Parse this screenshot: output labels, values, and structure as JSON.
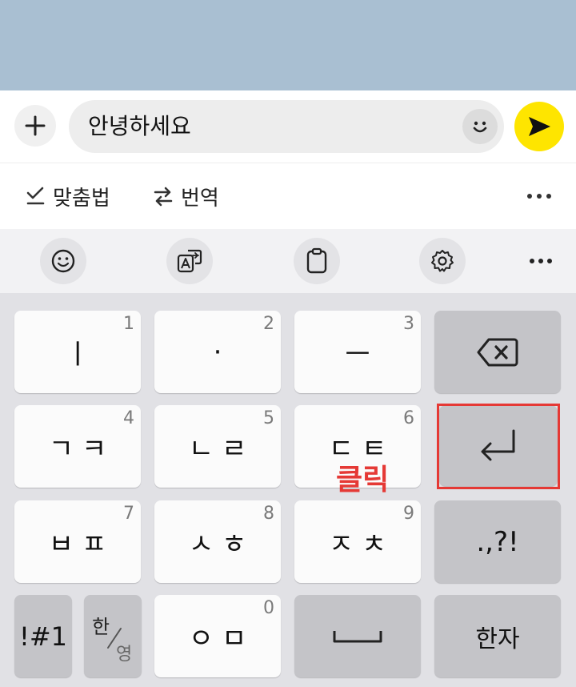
{
  "input_bar": {
    "message_text": "안녕하세요"
  },
  "suggestions": {
    "spellcheck_label": "맞춤법",
    "translate_label": "번역",
    "more_label": "···"
  },
  "toolbar": {
    "icons": [
      "emoji-icon",
      "translate-icon",
      "clipboard-icon",
      "settings-icon"
    ],
    "more_label": "···"
  },
  "keyboard": {
    "rows": [
      [
        {
          "label": "ㅣ",
          "num": "1"
        },
        {
          "label": "·",
          "num": "2"
        },
        {
          "label": "ㅡ",
          "num": "3"
        },
        {
          "label": "",
          "icon": "backspace-icon"
        }
      ],
      [
        {
          "label": "ㄱㅋ",
          "num": "4"
        },
        {
          "label": "ㄴㄹ",
          "num": "5"
        },
        {
          "label": "ㄷㅌ",
          "num": "6"
        },
        {
          "label": "",
          "icon": "enter-icon"
        }
      ],
      [
        {
          "label": "ㅂㅍ",
          "num": "7"
        },
        {
          "label": "ㅅㅎ",
          "num": "8"
        },
        {
          "label": "ㅈㅊ",
          "num": "9"
        },
        {
          "label": ".,?!"
        }
      ],
      [
        {
          "label": "!#1"
        },
        {
          "label_top": "한",
          "label_bottom": "영"
        },
        {
          "label": "ㅇㅁ",
          "num": "0"
        },
        {
          "label": "",
          "icon": "space-icon"
        },
        {
          "label": "한자"
        }
      ]
    ]
  },
  "annotation": {
    "click_label": "클릭",
    "highlight_color": "#e53935"
  },
  "colors": {
    "header_bg": "#a9bfd2",
    "send_button": "#fee500",
    "keyboard_bg": "#e1e1e5"
  }
}
